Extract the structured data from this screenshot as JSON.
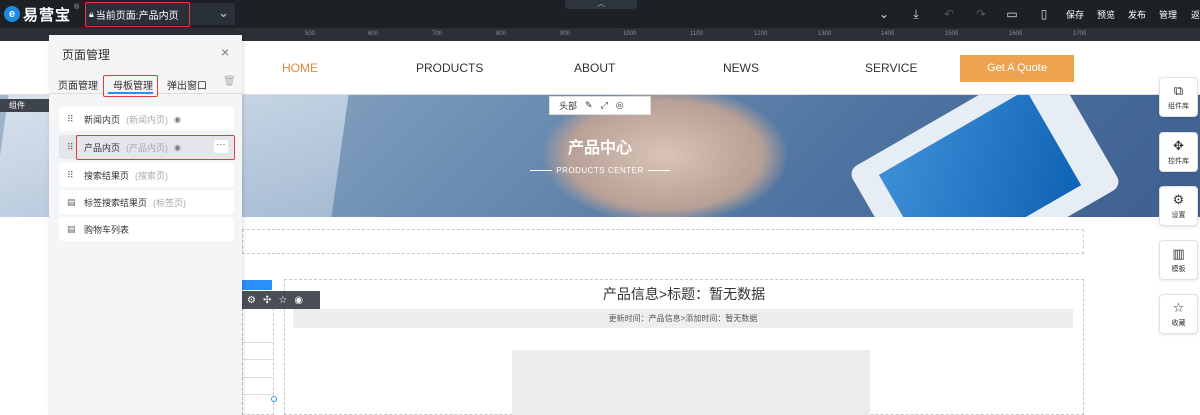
{
  "topbar": {
    "logo_text": "易营宝",
    "logo_mark": "e",
    "current_page_label": "当前页面:产品内页",
    "icons": [
      "chevron-down-icon",
      "layer-position-icon",
      "undo-icon",
      "redo-icon",
      "desktop-icon",
      "mobile-icon"
    ],
    "actions": [
      "保存",
      "预览",
      "发布",
      "管理",
      "返"
    ]
  },
  "ruler": {
    "ticks": [
      "500",
      "600",
      "700",
      "800",
      "900",
      "1000",
      "1100",
      "1200",
      "1300",
      "1400",
      "1500",
      "1600",
      "1700"
    ]
  },
  "site_header": {
    "nav": [
      "HOME",
      "PRODUCTS",
      "ABOUT",
      "NEWS",
      "SERVICE"
    ],
    "active_nav": "HOME",
    "quote_button": "Get A Quote",
    "accent_color": "#eea351"
  },
  "head_tools": {
    "label": "头部"
  },
  "banner": {
    "title": "产品中心",
    "subtitle": "PRODUCTS CENTER"
  },
  "content": {
    "title": "产品信息>标题：暂无数据",
    "meta": "更新时间：产品信息>添加时间：暂无数据"
  },
  "left_strip": {
    "label": "组件"
  },
  "panel": {
    "title": "页面管理",
    "tabs": [
      "页面管理",
      "母板管理",
      "弹出窗口"
    ],
    "active_tab": "母板管理",
    "items": [
      {
        "name": "新闻内页",
        "type": "(新闻内页)",
        "icon": "grid"
      },
      {
        "name": "产品内页",
        "type": "(产品内页)",
        "icon": "grid",
        "selected": true
      },
      {
        "name": "搜索结果页",
        "type": "(搜索页)",
        "icon": "grid"
      },
      {
        "name": "标签搜索结果页",
        "type": "(标签页)",
        "icon": "doc"
      },
      {
        "name": "购物车列表",
        "type": "",
        "icon": "doc"
      }
    ]
  },
  "right_tools": [
    {
      "label": "组件库",
      "icon": "copy-icon"
    },
    {
      "label": "控件库",
      "icon": "puzzle-icon"
    },
    {
      "label": "设置",
      "icon": "gear-icon"
    },
    {
      "label": "模板",
      "icon": "template-icon"
    },
    {
      "label": "收藏",
      "icon": "star-icon"
    }
  ],
  "highlight_color": "#e23b3b",
  "active_blue": "#2a8ff7"
}
